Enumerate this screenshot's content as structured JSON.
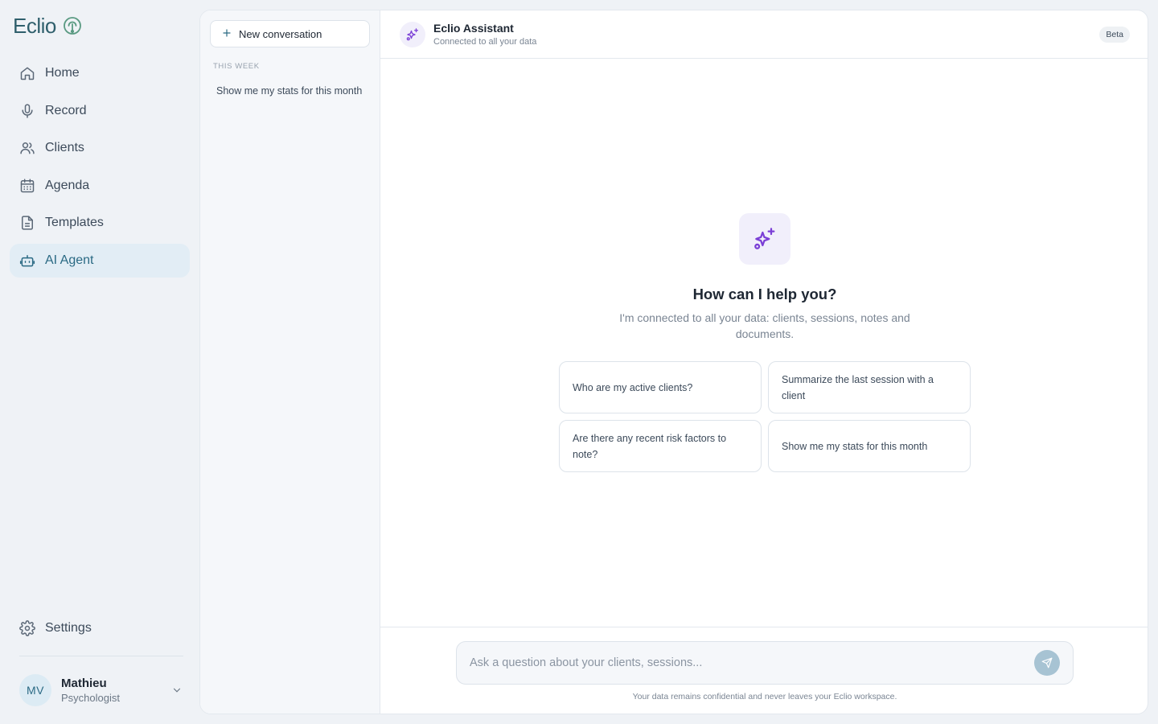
{
  "app": {
    "logo_text": "Eclio"
  },
  "colors": {
    "accent": "#2b6a84",
    "assistant_purple": "#7b3fd6",
    "nav_active_bg": "#e2edf5"
  },
  "nav": {
    "items": [
      {
        "label": "Home",
        "icon": "home-icon",
        "active": false
      },
      {
        "label": "Record",
        "icon": "microphone-icon",
        "active": false
      },
      {
        "label": "Clients",
        "icon": "users-icon",
        "active": false
      },
      {
        "label": "Agenda",
        "icon": "calendar-icon",
        "active": false
      },
      {
        "label": "Templates",
        "icon": "document-icon",
        "active": false
      },
      {
        "label": "AI Agent",
        "icon": "robot-icon",
        "active": true
      }
    ],
    "settings_label": "Settings"
  },
  "user": {
    "initials": "MV",
    "name": "Mathieu",
    "role": "Psychologist"
  },
  "history": {
    "new_conversation_label": "New conversation",
    "section_label": "THIS WEEK",
    "items": [
      {
        "title": "Show me my stats for this month"
      }
    ]
  },
  "chat": {
    "assistant_name": "Eclio Assistant",
    "assistant_subtitle": "Connected to all your data",
    "badge": "Beta",
    "empty_title": "How can I help you?",
    "empty_subtitle": "I'm connected to all your data: clients, sessions, notes and documents.",
    "suggestions": [
      "Who are my active clients?",
      "Summarize the last session with a client",
      "Are there any recent risk factors to note?",
      "Show me my stats for this month"
    ],
    "input_placeholder": "Ask a question about your clients, sessions...",
    "disclaimer": "Your data remains confidential and never leaves your Eclio workspace."
  }
}
